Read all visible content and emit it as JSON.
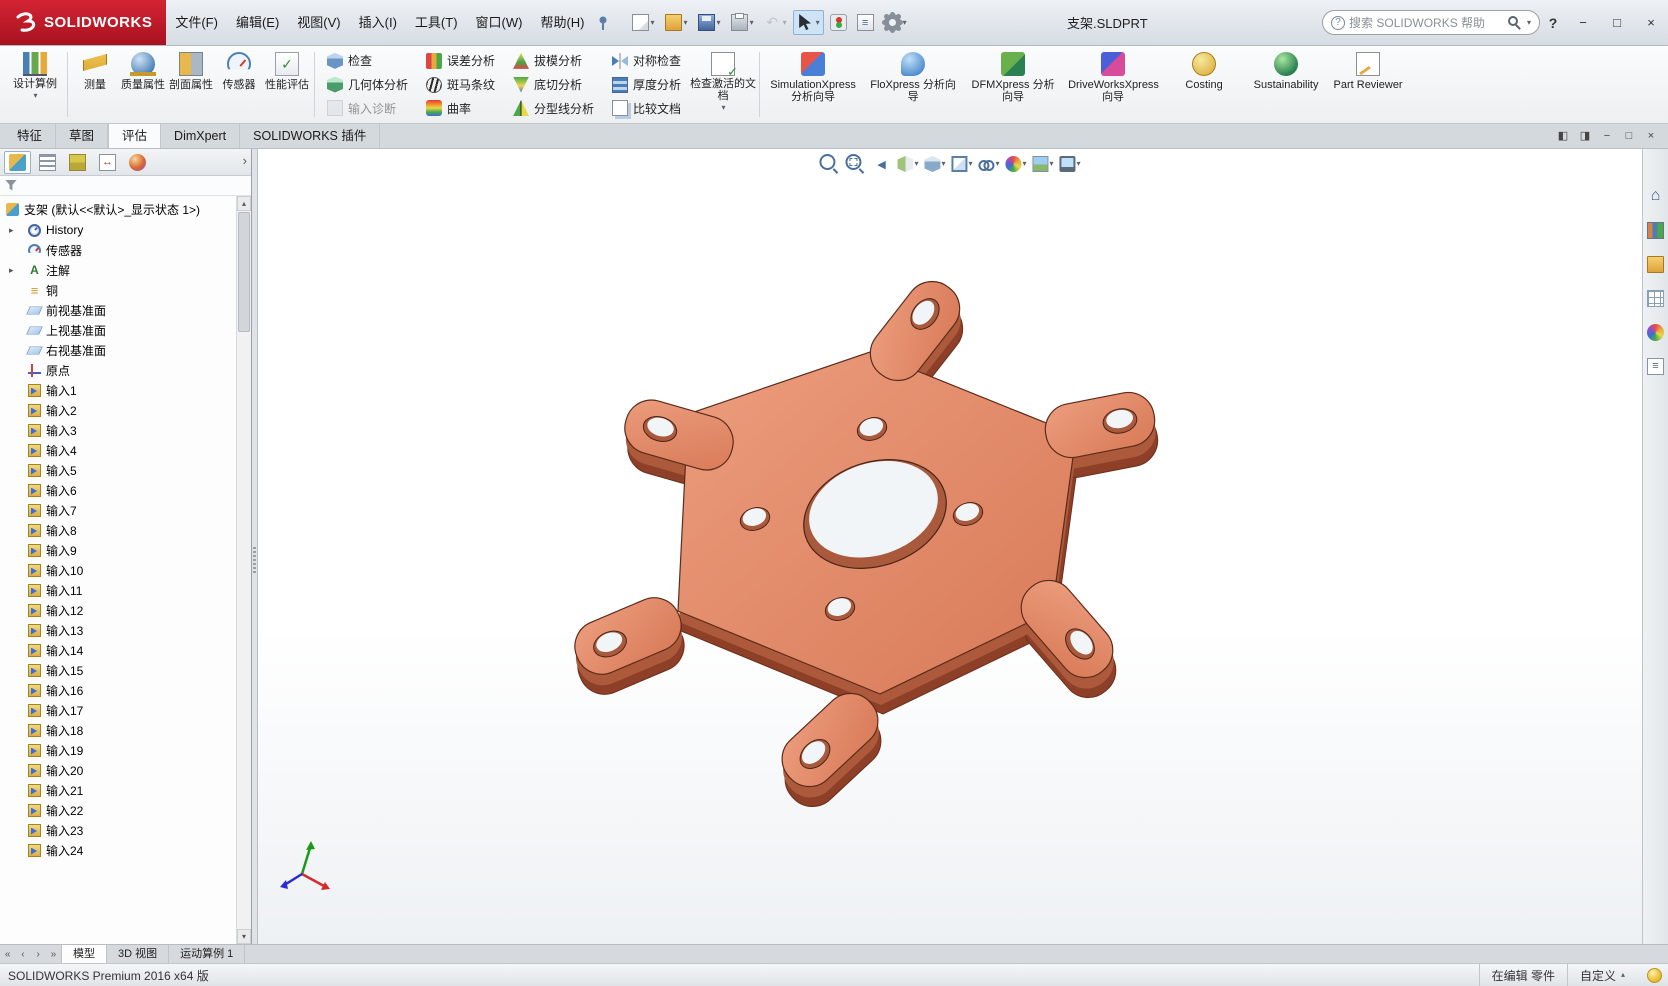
{
  "titlebar": {
    "logo_text": "SOLIDWORKS",
    "menus": [
      "文件(F)",
      "编辑(E)",
      "视图(V)",
      "插入(I)",
      "工具(T)",
      "窗口(W)",
      "帮助(H)"
    ],
    "quick_access": [
      {
        "icon": "new-document-icon",
        "caret": true
      },
      {
        "icon": "open-icon",
        "caret": true
      },
      {
        "icon": "save-icon",
        "caret": true
      },
      {
        "icon": "print-icon",
        "caret": true
      },
      {
        "icon": "undo-icon",
        "caret": true,
        "disabled": true
      },
      {
        "icon": "select-icon",
        "caret": true,
        "active": true
      },
      {
        "icon": "rebuild-icon"
      },
      {
        "icon": "file-properties-icon"
      },
      {
        "icon": "options-icon",
        "caret": true
      }
    ],
    "document_title": "支架.SLDPRT",
    "search_placeholder": "搜索 SOLIDWORKS 帮助",
    "help_label": "?",
    "window_controls": {
      "minimize": "−",
      "maximize": "□",
      "close": "×"
    }
  },
  "ribbon": {
    "design_study": {
      "label": "设计算例",
      "icon": "design-study-icon"
    },
    "measure_group": [
      {
        "label": "测量",
        "icon": "measure-icon"
      },
      {
        "label": "质量属性",
        "icon": "mass-properties-icon"
      },
      {
        "label": "剖面属性",
        "icon": "section-properties-icon"
      },
      {
        "label": "传感器",
        "icon": "sensor-icon"
      },
      {
        "label": "性能评估",
        "icon": "performance-icon"
      }
    ],
    "stacks": [
      [
        {
          "label": "检查",
          "icon": "check-entity-icon"
        },
        {
          "label": "几何体分析",
          "icon": "geometry-analysis-icon"
        },
        {
          "label": "输入诊断",
          "icon": "import-diagnostics-icon",
          "disabled": true
        }
      ],
      [
        {
          "label": "误差分析",
          "icon": "deviation-analysis-icon"
        },
        {
          "label": "斑马条纹",
          "icon": "zebra-stripes-icon"
        },
        {
          "label": "曲率",
          "icon": "curvature-icon"
        }
      ],
      [
        {
          "label": "拔模分析",
          "icon": "draft-analysis-icon"
        },
        {
          "label": "底切分析",
          "icon": "undercut-analysis-icon"
        },
        {
          "label": "分型线分析",
          "icon": "parting-line-icon"
        }
      ],
      [
        {
          "label": "对称检查",
          "icon": "symmetry-check-icon"
        },
        {
          "label": "厚度分析",
          "icon": "thickness-analysis-icon"
        },
        {
          "label": "比较文档",
          "icon": "compare-documents-icon"
        }
      ]
    ],
    "check_active_document": {
      "label": "检查激活的文档",
      "icon": "check-active-document-icon"
    },
    "wizards": [
      {
        "label": "SimulationXpress 分析向导",
        "icon": "simulationxpress-icon"
      },
      {
        "label": "FloXpress 分析向导",
        "icon": "floxpress-icon"
      },
      {
        "label": "DFMXpress 分析向导",
        "icon": "dfmxpress-icon"
      },
      {
        "label": "DriveWorksXpress 向导",
        "icon": "driveworksxpress-icon"
      },
      {
        "label": "Costing",
        "icon": "costing-icon"
      },
      {
        "label": "Sustainability",
        "icon": "sustainability-icon"
      },
      {
        "label": "Part Reviewer",
        "icon": "part-reviewer-icon"
      }
    ]
  },
  "ribbon_tabs": {
    "items": [
      "特征",
      "草图",
      "评估",
      "DimXpert",
      "SOLIDWORKS 插件"
    ],
    "active": "评估"
  },
  "document_window_controls": [
    "◧",
    "◨",
    "−",
    "□",
    "×"
  ],
  "view_toolbar": [
    {
      "icon": "zoom-fit-icon"
    },
    {
      "icon": "zoom-area-icon"
    },
    {
      "icon": "previous-view-icon"
    },
    {
      "icon": "section-view-icon",
      "caret": true
    },
    {
      "icon": "view-orientation-icon",
      "caret": true
    },
    {
      "icon": "display-style-icon",
      "caret": true
    },
    {
      "icon": "hide-show-items-icon",
      "caret": true
    },
    {
      "icon": "edit-appearance-icon",
      "caret": true
    },
    {
      "icon": "apply-scene-icon",
      "caret": true
    },
    {
      "icon": "view-settings-icon",
      "caret": true
    }
  ],
  "task_pane": [
    {
      "icon": "home-icon"
    },
    {
      "icon": "design-library-icon"
    },
    {
      "icon": "file-explorer-icon"
    },
    {
      "icon": "view-palette-icon"
    },
    {
      "icon": "appearances-icon"
    },
    {
      "icon": "custom-properties-icon"
    }
  ],
  "feature_panel": {
    "tabs": [
      {
        "icon": "featuremanager-icon",
        "active": true
      },
      {
        "icon": "propertymanager-icon"
      },
      {
        "icon": "configurationmanager-icon"
      },
      {
        "icon": "dimxpertmanager-icon"
      },
      {
        "icon": "displaymanager-icon"
      }
    ],
    "root": {
      "label": "支架 (默认<<默认>_显示状态 1>)",
      "icon": "part-icon"
    },
    "items": [
      {
        "label": "History",
        "icon": "history-icon",
        "arrow": true
      },
      {
        "label": "传感器",
        "icon": "sensors-icon"
      },
      {
        "label": "注解",
        "icon": "annotations-icon",
        "arrow": true
      },
      {
        "label": "铜",
        "icon": "material-icon"
      },
      {
        "label": "前视基准面",
        "icon": "plane-icon"
      },
      {
        "label": "上视基准面",
        "icon": "plane-icon"
      },
      {
        "label": "右视基准面",
        "icon": "plane-icon"
      },
      {
        "label": "原点",
        "icon": "origin-icon"
      },
      {
        "label": "输入1",
        "icon": "import-input-icon"
      },
      {
        "label": "输入2",
        "icon": "import-input-icon"
      },
      {
        "label": "输入3",
        "icon": "import-input-icon"
      },
      {
        "label": "输入4",
        "icon": "import-input-icon"
      },
      {
        "label": "输入5",
        "icon": "import-input-icon"
      },
      {
        "label": "输入6",
        "icon": "import-input-icon"
      },
      {
        "label": "输入7",
        "icon": "import-input-icon"
      },
      {
        "label": "输入8",
        "icon": "import-input-icon"
      },
      {
        "label": "输入9",
        "icon": "import-input-icon"
      },
      {
        "label": "输入10",
        "icon": "import-input-icon"
      },
      {
        "label": "输入11",
        "icon": "import-input-icon"
      },
      {
        "label": "输入12",
        "icon": "import-input-icon"
      },
      {
        "label": "输入13",
        "icon": "import-input-icon"
      },
      {
        "label": "输入14",
        "icon": "import-input-icon"
      },
      {
        "label": "输入15",
        "icon": "import-input-icon"
      },
      {
        "label": "输入16",
        "icon": "import-input-icon"
      },
      {
        "label": "输入17",
        "icon": "import-input-icon"
      },
      {
        "label": "输入18",
        "icon": "import-input-icon"
      },
      {
        "label": "输入19",
        "icon": "import-input-icon"
      },
      {
        "label": "输入20",
        "icon": "import-input-icon"
      },
      {
        "label": "输入21",
        "icon": "import-input-icon"
      },
      {
        "label": "输入22",
        "icon": "import-input-icon"
      },
      {
        "label": "输入23",
        "icon": "import-input-icon"
      },
      {
        "label": "输入24",
        "icon": "import-input-icon"
      }
    ]
  },
  "document_tabs": {
    "scroll_buttons": [
      "«",
      "‹",
      "›",
      "»"
    ],
    "tabs": [
      "模型",
      "3D 视图",
      "运动算例 1"
    ],
    "active": "模型"
  },
  "statusbar": {
    "left": "SOLIDWORKS Premium 2016 x64 版",
    "editing_status": "在编辑 零件",
    "custom_label": "自定义"
  },
  "part_colors": {
    "top_face": "#e18a6b",
    "side_face": "#ad5a3c",
    "dark_side": "#8d3f27",
    "edge": "#5b2c1b"
  }
}
